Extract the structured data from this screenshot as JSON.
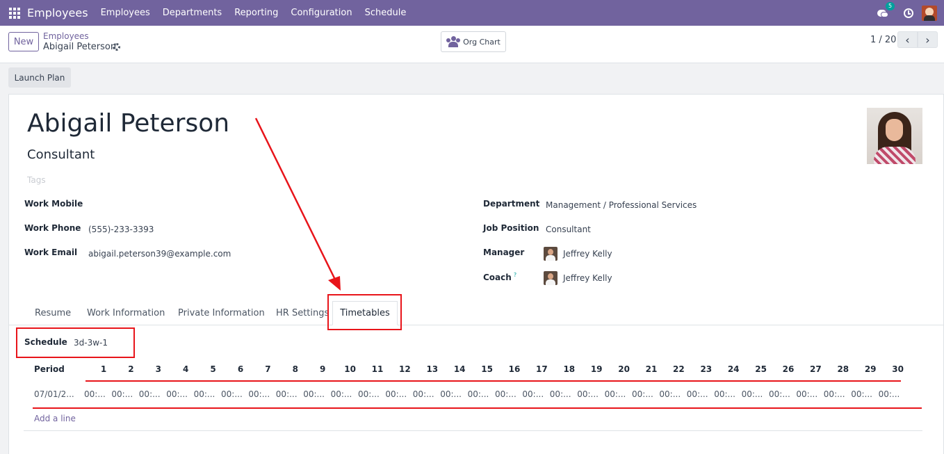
{
  "navbar": {
    "brand": "Employees",
    "menu": [
      "Employees",
      "Departments",
      "Reporting",
      "Configuration",
      "Schedule"
    ],
    "messages_badge": "5",
    "color": "#71639e"
  },
  "control": {
    "new_label": "New",
    "breadcrumb_parent": "Employees",
    "breadcrumb_current": "Abigail Peterson",
    "org_chart_label": "Org Chart",
    "pager": "1 / 20"
  },
  "status": {
    "launch_plan_label": "Launch Plan"
  },
  "employee": {
    "name": "Abigail Peterson",
    "job_title": "Consultant",
    "tags_placeholder": "Tags",
    "left_fields": [
      {
        "label": "Work Mobile",
        "value": ""
      },
      {
        "label": "Work Phone",
        "value": "(555)-233-3393"
      },
      {
        "label": "Work Email",
        "value": "abigail.peterson39@example.com"
      }
    ],
    "right_fields": [
      {
        "label": "Department",
        "value": "Management / Professional Services"
      },
      {
        "label": "Job Position",
        "value": "Consultant"
      },
      {
        "label": "Manager",
        "value": "Jeffrey Kelly"
      },
      {
        "label": "Coach",
        "value": "Jeffrey Kelly",
        "help": "?"
      }
    ]
  },
  "tabs": [
    "Resume",
    "Work Information",
    "Private Information",
    "HR Settings",
    "Timetables"
  ],
  "active_tab": "Timetables",
  "timetables": {
    "schedule_label": "Schedule",
    "schedule_value": "3d-3w-1",
    "period_header": "Period",
    "days": [
      "1",
      "2",
      "3",
      "4",
      "5",
      "6",
      "7",
      "8",
      "9",
      "10",
      "11",
      "12",
      "13",
      "14",
      "15",
      "16",
      "17",
      "18",
      "19",
      "20",
      "21",
      "22",
      "23",
      "24",
      "25",
      "26",
      "27",
      "28",
      "29",
      "30"
    ],
    "row_period": "07/01/2...",
    "row_cell": "00:...",
    "add_line_label": "Add a line"
  },
  "annotation_color": "#e8141a"
}
